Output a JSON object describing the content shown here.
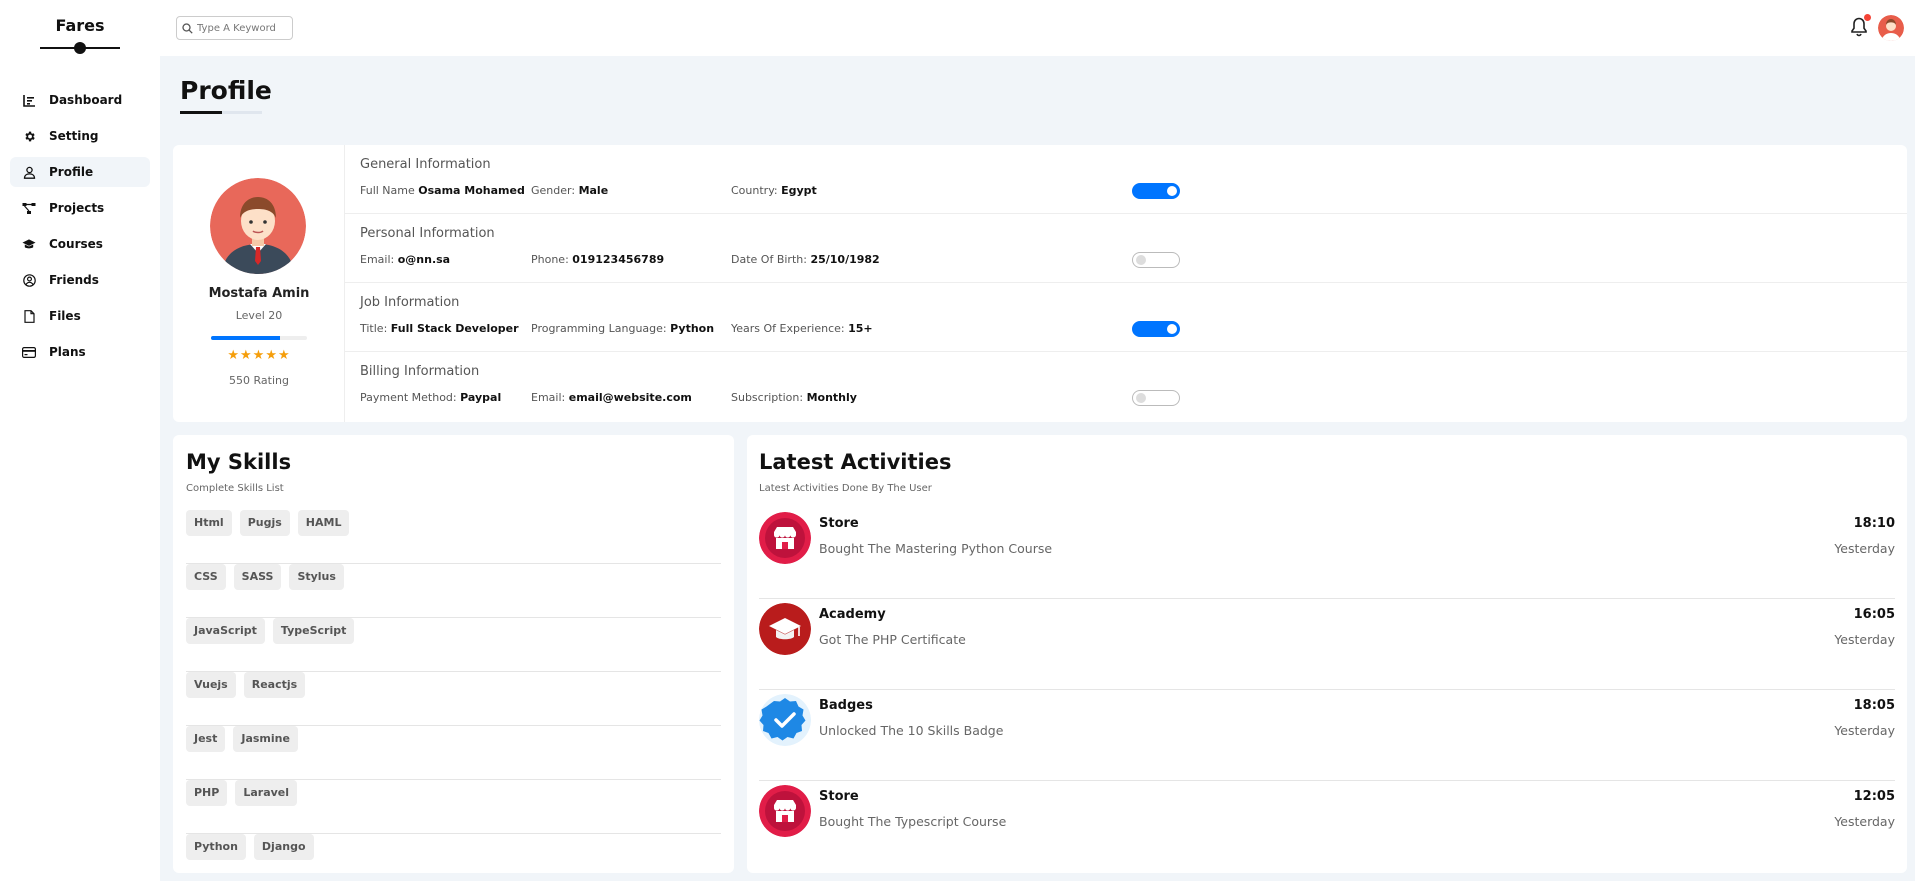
{
  "brand": {
    "title": "Fares"
  },
  "nav": [
    {
      "label": "Dashboard",
      "icon": "chart-icon"
    },
    {
      "label": "Setting",
      "icon": "gear-icon"
    },
    {
      "label": "Profile",
      "icon": "user-icon",
      "active": true
    },
    {
      "label": "Projects",
      "icon": "diagram-icon"
    },
    {
      "label": "Courses",
      "icon": "graduation-cap-icon"
    },
    {
      "label": "Friends",
      "icon": "user-circle-icon"
    },
    {
      "label": "Files",
      "icon": "file-icon"
    },
    {
      "label": "Plans",
      "icon": "credit-card-icon"
    }
  ],
  "header": {
    "search_placeholder": "Type A Keyword"
  },
  "page": {
    "title": "Profile"
  },
  "profile": {
    "name": "Mostafa Amin",
    "level": "Level 20",
    "level_progress": 0.72,
    "stars": "★★★★★",
    "rating": "550 Rating"
  },
  "info_sections": [
    {
      "title": "General Information",
      "fields": [
        {
          "label": "Full Name",
          "value": "Osama Mohamed"
        },
        {
          "label": "Gender:",
          "value": "Male"
        },
        {
          "label": "Country:",
          "value": "Egypt"
        }
      ],
      "toggle_on": true
    },
    {
      "title": "Personal Information",
      "fields": [
        {
          "label": "Email:",
          "value": "o@nn.sa"
        },
        {
          "label": "Phone:",
          "value": "019123456789"
        },
        {
          "label": "Date Of Birth:",
          "value": "25/10/1982"
        }
      ],
      "toggle_on": false
    },
    {
      "title": "Job Information",
      "fields": [
        {
          "label": "Title:",
          "value": "Full Stack Developer"
        },
        {
          "label": "Programming Language:",
          "value": "Python"
        },
        {
          "label": "Years Of Experience:",
          "value": "15+"
        }
      ],
      "toggle_on": true
    },
    {
      "title": "Billing Information",
      "fields": [
        {
          "label": "Payment Method:",
          "value": "Paypal"
        },
        {
          "label": "Email:",
          "value": "email@website.com"
        },
        {
          "label": "Subscription:",
          "value": "Monthly"
        }
      ],
      "toggle_on": false
    }
  ],
  "skills": {
    "title": "My Skills",
    "subtitle": "Complete Skills List",
    "rows": [
      [
        "Html",
        "Pugjs",
        "HAML"
      ],
      [
        "CSS",
        "SASS",
        "Stylus"
      ],
      [
        "JavaScript",
        "TypeScript"
      ],
      [
        "Vuejs",
        "Reactjs"
      ],
      [
        "Jest",
        "Jasmine"
      ],
      [
        "PHP",
        "Laravel"
      ],
      [
        "Python",
        "Django"
      ]
    ]
  },
  "activities": {
    "title": "Latest Activities",
    "subtitle": "Latest Activities Done By The User",
    "items": [
      {
        "name": "Store",
        "desc": "Bought The Mastering Python Course",
        "time": "18:10",
        "day": "Yesterday",
        "icon": "store-icon",
        "color": "#e11d48"
      },
      {
        "name": "Academy",
        "desc": "Got The PHP Certificate",
        "time": "16:05",
        "day": "Yesterday",
        "icon": "graduation-cap-icon",
        "color": "#b91c1c"
      },
      {
        "name": "Badges",
        "desc": "Unlocked The 10 Skills Badge",
        "time": "18:05",
        "day": "Yesterday",
        "icon": "badge-check-icon",
        "color": "#1e88e5"
      },
      {
        "name": "Store",
        "desc": "Bought The Typescript Course",
        "time": "12:05",
        "day": "Yesterday",
        "icon": "store-icon",
        "color": "#e11d48"
      }
    ]
  },
  "colors": {
    "accent": "#0075ff",
    "star": "#f59e0b",
    "notify": "#f44336"
  }
}
